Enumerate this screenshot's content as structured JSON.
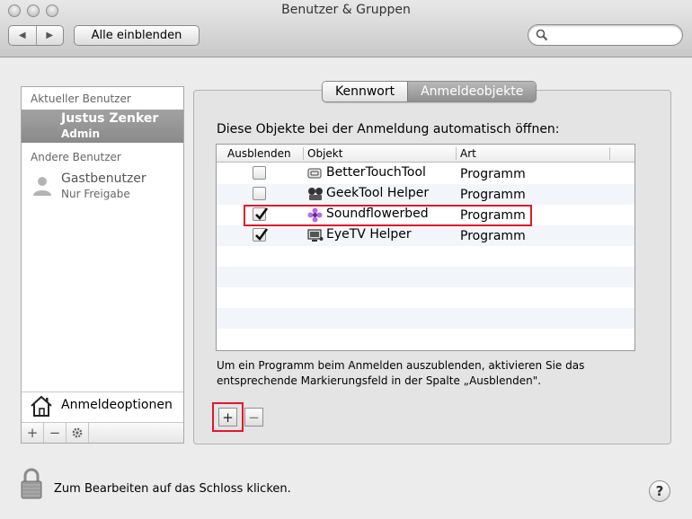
{
  "window": {
    "title": "Benutzer & Gruppen",
    "show_all_label": "Alle einblenden",
    "back_glyph": "◀",
    "forward_glyph": "▶",
    "search_placeholder": ""
  },
  "sidebar": {
    "current_heading": "Aktueller Benutzer",
    "current_user": {
      "name": "Justus Zenker",
      "role": "Admin"
    },
    "other_heading": "Andere Benutzer",
    "other_users": [
      {
        "name": "Gastbenutzer",
        "role": "Nur Freigabe",
        "icon": "person-icon"
      }
    ],
    "login_options_label": "Anmeldeoptionen",
    "toolbar": {
      "add": "+",
      "remove": "−"
    }
  },
  "tabs": [
    {
      "label": "Kennwort",
      "active": false
    },
    {
      "label": "Anmeldeobjekte",
      "active": true
    }
  ],
  "main": {
    "instruction": "Diese Objekte bei der Anmeldung automatisch öffnen:",
    "columns": [
      "Ausblenden",
      "Objekt",
      "Art"
    ],
    "items": [
      {
        "hide": false,
        "name": "BetterTouchTool",
        "type": "Programm",
        "icon": "bettertouchtool-icon"
      },
      {
        "hide": false,
        "name": "GeekTool Helper",
        "type": "Programm",
        "icon": "geektool-icon"
      },
      {
        "hide": true,
        "name": "Soundflowerbed",
        "type": "Programm",
        "icon": "soundflower-icon"
      },
      {
        "hide": true,
        "name": "EyeTV Helper",
        "type": "Programm",
        "icon": "eyetv-icon"
      }
    ],
    "help_line1": "Um ein Programm beim Anmelden auszublenden, aktivieren Sie das",
    "help_line2": "entsprechende Markierungsfeld in der Spalte „Ausblenden\".",
    "add_button": "+",
    "remove_button": "−"
  },
  "footer": {
    "lock_text": "Zum Bearbeiten auf das Schloss klicken.",
    "help_button": "?"
  },
  "colors": {
    "highlight": "#e0192c",
    "selection": "#8f8f8f"
  }
}
